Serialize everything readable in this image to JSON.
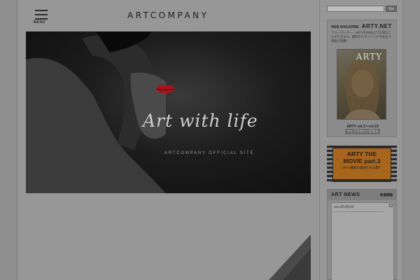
{
  "header": {
    "menu_label": "MENU",
    "logo": "ARTCOMPANY"
  },
  "hero": {
    "tagline": "Art with life",
    "subtag": "ARTCOMPANY OFFICIAL SITE"
  },
  "search": {
    "value": "",
    "button_label": "Go"
  },
  "magazine": {
    "label_small": "WEB MAGAZINE",
    "label_big": "ARTY.NET",
    "description": "フリーペーパー・ARTYをWEB上でも読むことができます。最新のスタイリングや役立つ情報が満載！",
    "cover_title": "ARTY",
    "volumes": "ARTY vol.1〜vol.19",
    "button_label": "ウェブマガジンを見る"
  },
  "banner": {
    "line1": "ARTY THE",
    "line2": "MOVIE part.3",
    "line3": "ARTY撮影の裏側を大公開！"
  },
  "news": {
    "title": "ART NEWS",
    "more_label": "新着情報",
    "items": [
      {
        "date": "2014年3月3日"
      }
    ]
  },
  "colors": {
    "hero_bg": "#111111",
    "banner_orange": "#a8661c",
    "overlay_gray": "#979797"
  },
  "icons": {
    "menu": "hamburger-icon",
    "scroll": "scroll-up-icon"
  }
}
